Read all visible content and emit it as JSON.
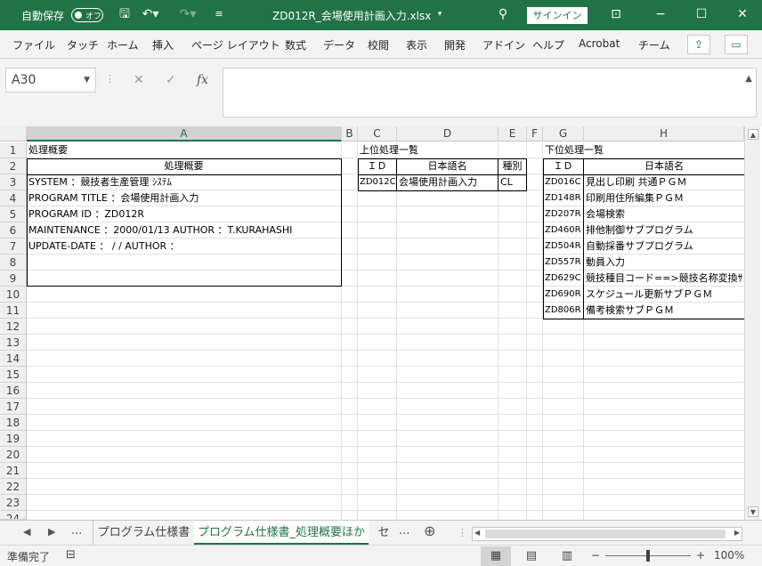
{
  "titlebar": {
    "autosave_label": "自動保存",
    "autosave_state": "オフ",
    "filename": "ZD012R_会場使用計画入力.xlsx",
    "signin": "サインイン"
  },
  "ribbon": {
    "tabs": [
      "ファイル",
      "タッチ",
      "ホーム",
      "挿入",
      "ページ レイアウト",
      "数式",
      "データ",
      "校閲",
      "表示",
      "開発",
      "アドイン",
      "ヘルプ",
      "Acrobat",
      "チーム"
    ]
  },
  "formula_bar": {
    "name_box": "A30",
    "fx": "fx",
    "value": ""
  },
  "columns": [
    "A",
    "B",
    "C",
    "D",
    "E",
    "F",
    "G",
    "H"
  ],
  "selected_column": "A",
  "rows": [
    "1",
    "2",
    "3",
    "4",
    "5",
    "6",
    "7",
    "8",
    "9",
    "10",
    "11",
    "12",
    "13",
    "14",
    "15",
    "16",
    "17",
    "18",
    "19",
    "20",
    "21",
    "22",
    "23",
    "24"
  ],
  "sheet": {
    "left_title": "処理概要",
    "left_header": "処理概要",
    "left_lines": [
      "SYSTEM       ：競技者生産管理 ｼｽﾃﾑ",
      "PROGRAM TITLE ：会場使用計画入力",
      "PROGRAM ID    ：ZD012R",
      "MAINTENANCE   ：2000/01/13      AUTHOR ：T.KURAHASHI",
      "UPDATE-DATE   ：    /  /        AUTHOR ："
    ],
    "upper": {
      "title": "上位処理一覧",
      "h_id": "ＩＤ",
      "h_name": "日本語名",
      "h_type": "種別",
      "rows": [
        {
          "id": "ZD012C",
          "name": "会場使用計画入力",
          "type": "CL"
        }
      ]
    },
    "lower": {
      "title": "下位処理一覧",
      "h_id": "ＩＤ",
      "h_name": "日本語名",
      "rows": [
        {
          "id": "ZD016C",
          "name": "見出し印刷 共通ＰＧＭ"
        },
        {
          "id": "ZD148R",
          "name": "印刷用住所編集ＰＧＭ"
        },
        {
          "id": "ZD207R",
          "name": "会場検索"
        },
        {
          "id": "ZD460R",
          "name": "排他制御サブプログラム"
        },
        {
          "id": "ZD504R",
          "name": "自動採番サブプログラム"
        },
        {
          "id": "ZD557R",
          "name": "動員入力"
        },
        {
          "id": "ZD629C",
          "name": "競技種目コード==>競技名称変換ｻ"
        },
        {
          "id": "ZD690R",
          "name": "スケジュール更新サブＰＧＭ"
        },
        {
          "id": "ZD806R",
          "name": "備考検索サブＰＧＭ"
        }
      ]
    }
  },
  "sheet_tabs": {
    "ellipsis": "...",
    "tabs": [
      "プログラム仕様書",
      "プログラム仕様書_処理概要ほか",
      "セ"
    ],
    "more": "...",
    "active_index": 1
  },
  "status": {
    "ready": "準備完了",
    "zoom": "100%",
    "zoom_level": 1.0
  }
}
